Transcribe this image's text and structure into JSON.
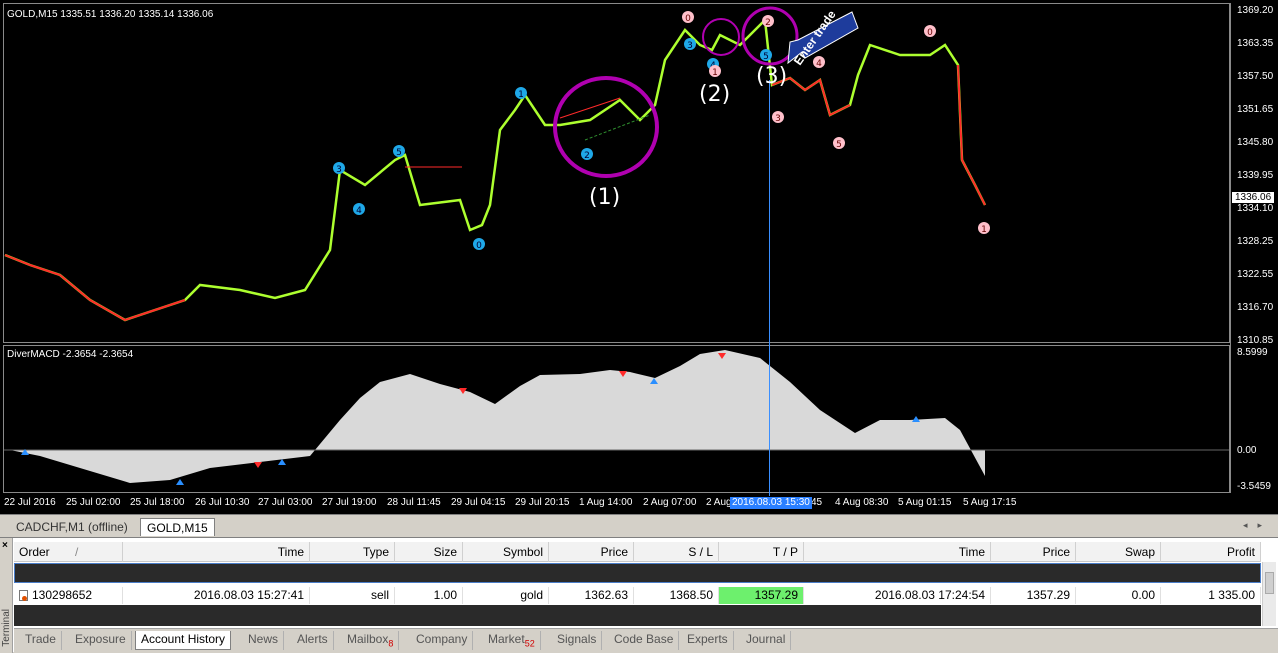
{
  "chart": {
    "title": "GOLD,M15  1335.51 1336.20 1335.14 1336.06",
    "indicator_title": "DiverMACD -2.3654 -2.3654",
    "price_axis": [
      "1369.20",
      "1363.35",
      "1357.50",
      "1351.65",
      "1345.80",
      "1339.95",
      "1334.10",
      "1328.25",
      "1322.55",
      "1316.70",
      "1310.85"
    ],
    "current_price": "1336.06",
    "indicator_axis": [
      "8.5999",
      "0.00",
      "-3.5459"
    ],
    "time_axis": [
      "22 Jul 2016",
      "25 Jul 02:00",
      "25 Jul 18:00",
      "26 Jul 10:30",
      "27 Jul 03:00",
      "27 Jul 19:00",
      "28 Jul 11:45",
      "29 Jul 04:15",
      "29 Jul 20:15",
      "1 Aug 14:00",
      "2 Aug 07:00",
      "2 Aug",
      "45",
      "4 Aug 08:30",
      "5 Aug 01:15",
      "5 Aug 17:15"
    ],
    "crosshair_time": "2016.08.03 15:30",
    "annotations": {
      "a1": "(1)",
      "a2": "(2)",
      "a3": "(3)",
      "enter": "Enter trade"
    },
    "markers": {
      "blue": [
        "2",
        "4",
        "3",
        "5",
        "1",
        "0",
        "3",
        "4",
        "5"
      ],
      "pink": [
        "0",
        "1",
        "2",
        "4",
        "3",
        "5",
        "0",
        "1"
      ]
    },
    "colors": {
      "bull": "#adff2f",
      "bear": "#ff2a2a",
      "circle": "#b000b0",
      "arrow": "#1e3c9c",
      "macd": "#d9d9d9"
    }
  },
  "chart_tabs": [
    {
      "label": "CADCHF,M1 (offline)",
      "active": false
    },
    {
      "label": "GOLD,M15",
      "active": true
    }
  ],
  "terminal": {
    "side_label": "Terminal",
    "close_glyph": "×",
    "columns": [
      "Order",
      "Time",
      "Type",
      "Size",
      "Symbol",
      "Price",
      "S / L",
      "T / P",
      "Time",
      "Price",
      "Swap",
      "Profit"
    ],
    "sort_glyph": "/",
    "row": {
      "order": "130298652",
      "open_time": "2016.08.03 15:27:41",
      "type": "sell",
      "size": "1.00",
      "symbol": "gold",
      "price": "1362.63",
      "sl": "1368.50",
      "tp": "1357.29",
      "close_time": "2016.08.03 17:24:54",
      "close_price": "1357.29",
      "swap": "0.00",
      "profit": "1 335.00"
    },
    "tabs": [
      {
        "label": "Trade"
      },
      {
        "label": "Exposure"
      },
      {
        "label": "Account History",
        "active": true
      },
      {
        "label": "News"
      },
      {
        "label": "Alerts"
      },
      {
        "label": "Mailbox",
        "badge": "8"
      },
      {
        "label": "Company"
      },
      {
        "label": "Market",
        "badge": "52"
      },
      {
        "label": "Signals"
      },
      {
        "label": "Code Base"
      },
      {
        "label": "Experts"
      },
      {
        "label": "Journal"
      }
    ]
  }
}
